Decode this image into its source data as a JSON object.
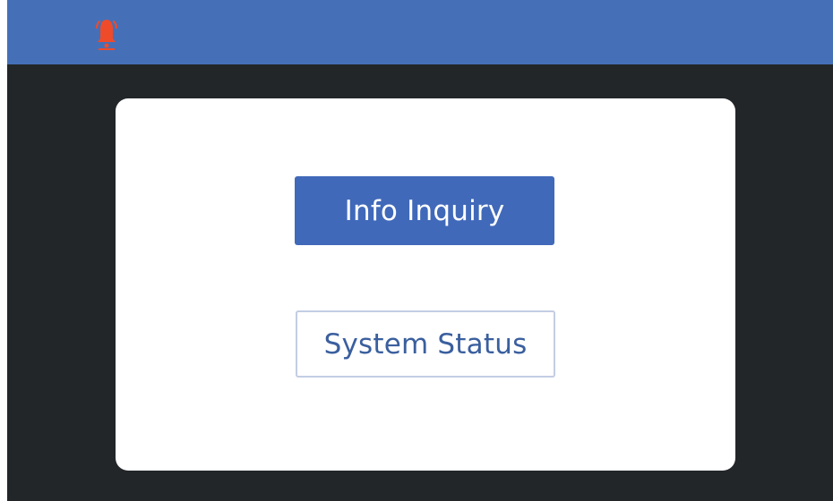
{
  "header": {
    "alarm_icon": "bell-alarm-icon",
    "background_color": "#4570b8",
    "alarm_color": "#ee4b2b"
  },
  "menu": {
    "info_inquiry_label": "Info Inquiry",
    "system_status_label": "System Status",
    "primary_color": "#4169b9"
  }
}
